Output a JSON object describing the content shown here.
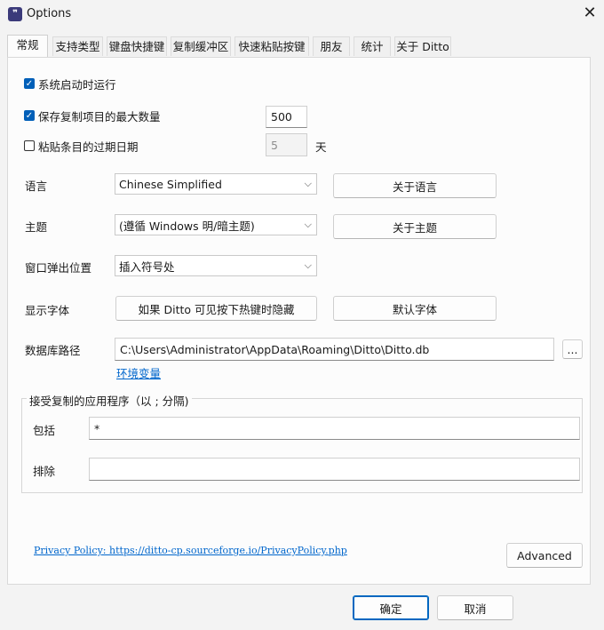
{
  "window": {
    "title": "Options",
    "icon": "ditto-app-icon"
  },
  "tabs": [
    {
      "label": "常规",
      "active": true
    },
    {
      "label": "支持类型"
    },
    {
      "label": "键盘快捷键"
    },
    {
      "label": "复制缓冲区"
    },
    {
      "label": "快速粘贴按键"
    },
    {
      "label": "朋友"
    },
    {
      "label": "统计"
    },
    {
      "label": "关于 Ditto"
    }
  ],
  "general": {
    "startup": {
      "label": "系统启动时运行",
      "checked": true
    },
    "max_saved": {
      "label": "保存复制项目的最大数量",
      "checked": true,
      "value": "500"
    },
    "expire": {
      "label": "粘贴条目的过期日期",
      "checked": false,
      "value": "5",
      "unit": "天"
    },
    "language": {
      "label": "语言",
      "value": "Chinese Simplified",
      "button": "关于语言"
    },
    "theme": {
      "label": "主题",
      "value": "(遵循 Windows 明/暗主题)",
      "button": "关于主题"
    },
    "popup": {
      "label": "窗口弹出位置",
      "value": "插入符号处"
    },
    "font": {
      "label": "显示字体",
      "button1": "如果 Ditto 可见按下热键时隐藏",
      "button2": "默认字体"
    },
    "db": {
      "label": "数据库路径",
      "value": "C:\\Users\\Administrator\\AppData\\Roaming\\Ditto\\Ditto.db",
      "browse": "...",
      "env_link": "环境变量"
    },
    "apps": {
      "title": "接受复制的应用程序（以 ; 分隔)",
      "include_label": "包括",
      "include_value": "*",
      "exclude_label": "排除",
      "exclude_value": ""
    },
    "privacy": "Privacy Policy: https://ditto-cp.sourceforge.io/PrivacyPolicy.php",
    "advanced": "Advanced"
  },
  "footer": {
    "ok": "确定",
    "cancel": "取消"
  }
}
